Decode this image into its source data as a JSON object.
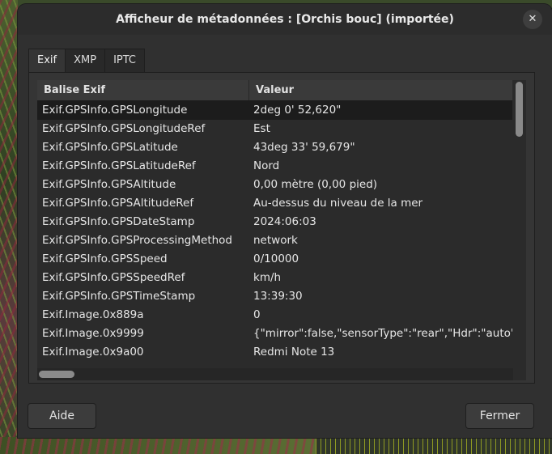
{
  "window": {
    "title": "Afficheur de métadonnées : [Orchis bouc] (importée)",
    "close_glyph": "✕"
  },
  "tabs": [
    {
      "label": "Exif",
      "active": true
    },
    {
      "label": "XMP",
      "active": false
    },
    {
      "label": "IPTC",
      "active": false
    }
  ],
  "table": {
    "columns": [
      "Balise Exif",
      "Valeur"
    ],
    "rows": [
      {
        "key": "Exif.GPSInfo.GPSLongitude",
        "value": "2deg 0' 52,620\"",
        "selected": true
      },
      {
        "key": "Exif.GPSInfo.GPSLongitudeRef",
        "value": "Est"
      },
      {
        "key": "Exif.GPSInfo.GPSLatitude",
        "value": "43deg 33' 59,679\""
      },
      {
        "key": "Exif.GPSInfo.GPSLatitudeRef",
        "value": "Nord"
      },
      {
        "key": "Exif.GPSInfo.GPSAltitude",
        "value": "0,00 mètre (0,00 pied)"
      },
      {
        "key": "Exif.GPSInfo.GPSAltitudeRef",
        "value": "Au-dessus du niveau de la mer"
      },
      {
        "key": "Exif.GPSInfo.GPSDateStamp",
        "value": "2024:06:03"
      },
      {
        "key": "Exif.GPSInfo.GPSProcessingMethod",
        "value": "network"
      },
      {
        "key": "Exif.GPSInfo.GPSSpeed",
        "value": "0/10000"
      },
      {
        "key": "Exif.GPSInfo.GPSSpeedRef",
        "value": "km/h"
      },
      {
        "key": "Exif.GPSInfo.GPSTimeStamp",
        "value": "13:39:30"
      },
      {
        "key": "Exif.Image.0x889a",
        "value": "0"
      },
      {
        "key": "Exif.Image.0x9999",
        "value": "{\"mirror\":false,\"sensorType\":\"rear\",\"Hdr\":\"auto\""
      },
      {
        "key": "Exif.Image.0x9a00",
        "value": "Redmi Note 13"
      }
    ]
  },
  "buttons": {
    "help_label": "Aide",
    "close_label": "Fermer"
  }
}
